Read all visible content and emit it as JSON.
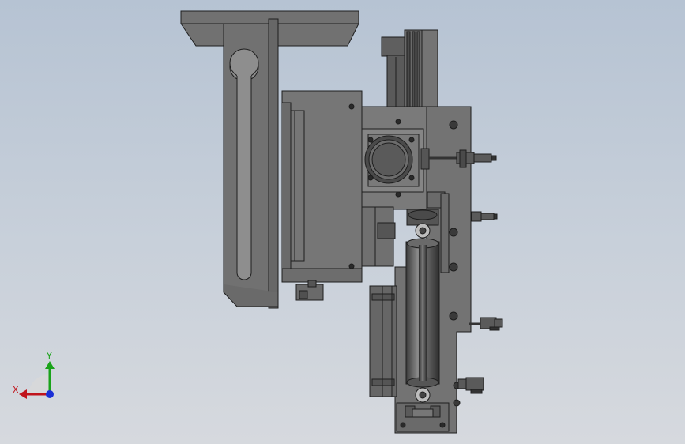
{
  "viewport": {
    "background_top": "#b6c3d3",
    "background_bottom": "#d6d9de",
    "model_fill": "#6f6f6f",
    "model_edge": "#1e1e1e"
  },
  "triad": {
    "x_label": "X",
    "y_label": "Y",
    "x_color": "#c0141c",
    "y_color": "#1aa31a",
    "z_color": "#1a2fd6"
  }
}
